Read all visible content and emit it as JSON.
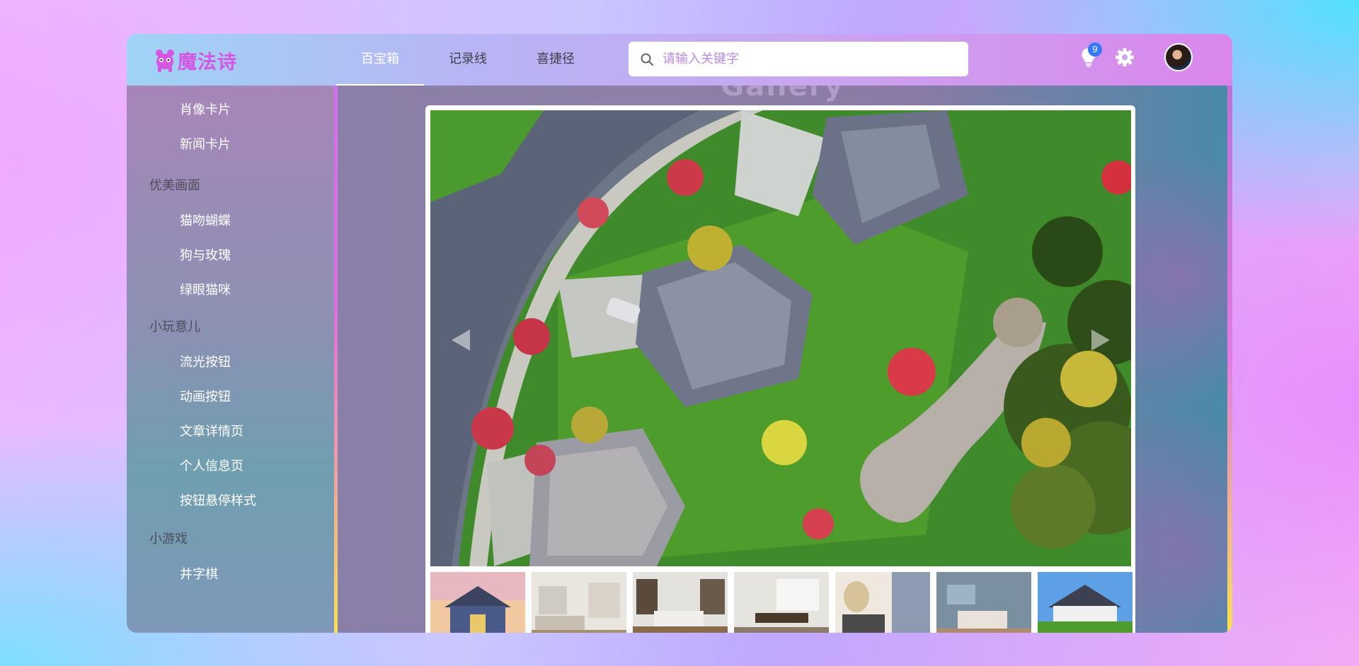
{
  "app": {
    "logo_text": "魔法诗"
  },
  "header": {
    "nav": [
      {
        "label": "百宝箱",
        "active": true
      },
      {
        "label": "记录线",
        "active": false
      },
      {
        "label": "喜捷径",
        "active": false
      }
    ],
    "search": {
      "placeholder": "请输入关键字",
      "value": ""
    },
    "notifications": {
      "icon": "lightbulb-icon",
      "count": "9"
    },
    "settings_icon": "gear-icon",
    "avatar_icon": "user-avatar"
  },
  "sidebar": {
    "sections": [
      {
        "group": "",
        "items": [
          "肖像卡片",
          "新闻卡片"
        ]
      },
      {
        "group": "优美画面",
        "items": [
          "猫吻蝴蝶",
          "狗与玫瑰",
          "绿眼猫咪"
        ]
      },
      {
        "group": "小玩意儿",
        "items": [
          "流光按钮",
          "动画按钮",
          "文章详情页",
          "个人信息页",
          "按钮悬停样式"
        ]
      },
      {
        "group": "小游戏",
        "items": [
          "井字棋"
        ]
      }
    ]
  },
  "main": {
    "gallery_title": "Gallery",
    "main_photo": "aerial-view-houses-image",
    "thumbnails": [
      "house-exterior-thumb",
      "living-room-thumb",
      "kitchen-thumb",
      "dining-room-thumb",
      "bathroom-thumb",
      "bedroom-thumb",
      "white-house-lawn-thumb"
    ]
  },
  "colors": {
    "accent": "#d556e4",
    "badge": "#3479f6",
    "nav_active": "#ffffff"
  }
}
